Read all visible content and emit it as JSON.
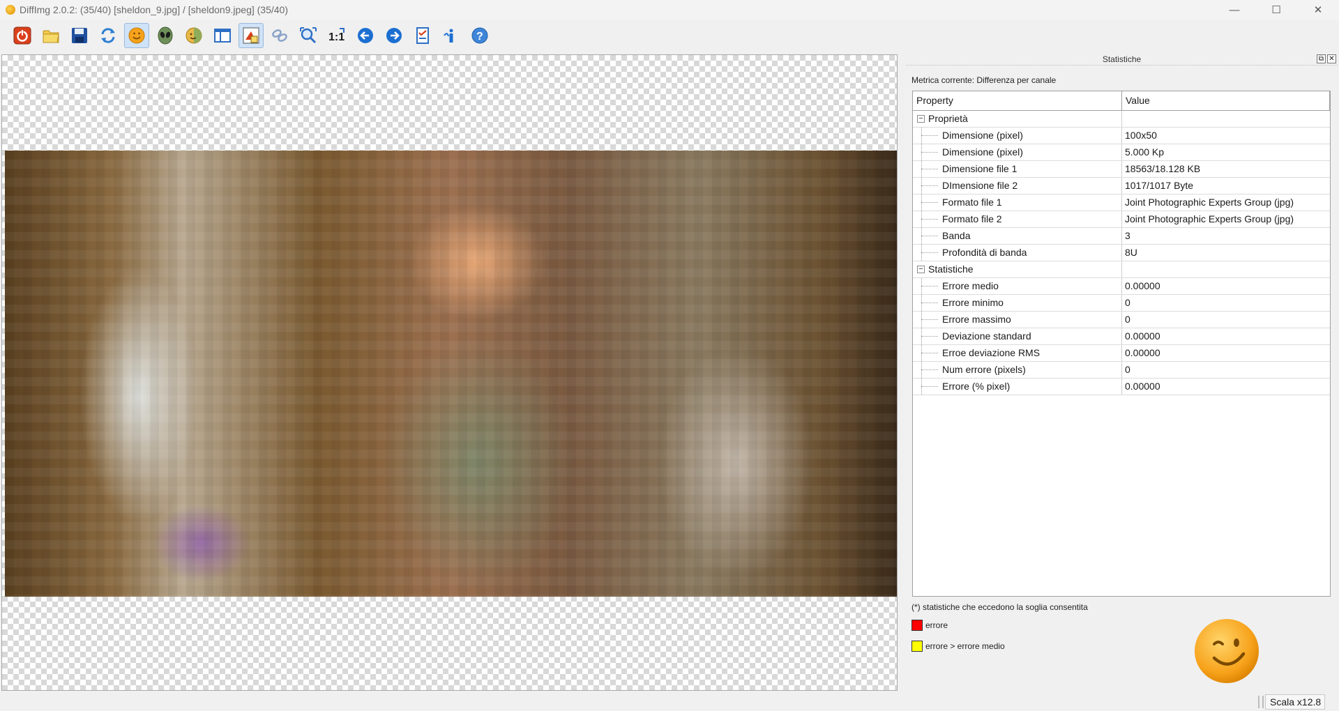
{
  "window": {
    "title": "DiffImg 2.0.2:  (35/40) [sheldon_9.jpg] / [sheldon9.jpeg] (35/40)",
    "minimize": "—",
    "maximize": "☐",
    "close": "✕"
  },
  "toolbar": {
    "buttons": [
      {
        "icon": "power-icon"
      },
      {
        "icon": "folder-open-icon"
      },
      {
        "icon": "save-icon"
      },
      {
        "icon": "refresh-icon"
      },
      {
        "icon": "smiley-icon",
        "active": true
      },
      {
        "icon": "alien-icon"
      },
      {
        "icon": "smiley-alt-icon"
      },
      {
        "icon": "split-view-icon"
      },
      {
        "icon": "highlight-diff-icon",
        "active": true
      },
      {
        "icon": "link-icon"
      },
      {
        "icon": "zoom-fit-icon"
      },
      {
        "icon": "zoom-actual-icon"
      },
      {
        "icon": "previous-icon"
      },
      {
        "icon": "next-icon"
      },
      {
        "icon": "checklist-icon"
      },
      {
        "icon": "info-icon"
      },
      {
        "icon": "help-icon"
      }
    ],
    "zoom_actual_label": "1:1"
  },
  "panel": {
    "title": "Statistiche",
    "float_btn": "⧉",
    "close_btn": "✕",
    "metric": "Metrica corrente: Differenza per canale",
    "table": {
      "col_property": "Property",
      "col_value": "Value",
      "groups": [
        {
          "name": "Proprietà",
          "expander": "−",
          "rows": [
            {
              "prop": "Dimensione (pixel)",
              "value": "100x50"
            },
            {
              "prop": "Dimensione (pixel)",
              "value": "5.000 Kp"
            },
            {
              "prop": "Dimensione file 1",
              "value": "18563/18.128 KB"
            },
            {
              "prop": "DImensione file 2",
              "value": "1017/1017 Byte"
            },
            {
              "prop": "Formato file 1",
              "value": "Joint Photographic Experts Group (jpg)"
            },
            {
              "prop": "Formato file 2",
              "value": "Joint Photographic Experts Group (jpg)"
            },
            {
              "prop": "Banda",
              "value": "3"
            },
            {
              "prop": "Profondità di banda",
              "value": "8U"
            }
          ]
        },
        {
          "name": "Statistiche",
          "expander": "−",
          "rows": [
            {
              "prop": "Errore medio",
              "value": "0.00000"
            },
            {
              "prop": "Errore minimo",
              "value": "0"
            },
            {
              "prop": "Errore massimo",
              "value": "0"
            },
            {
              "prop": "Deviazione standard",
              "value": "0.00000"
            },
            {
              "prop": "Erroe deviazione RMS",
              "value": "0.00000"
            },
            {
              "prop": "Num errore (pixels)",
              "value": "0"
            },
            {
              "prop": "Errore (% pixel)",
              "value": "0.00000"
            }
          ]
        }
      ]
    },
    "note": "(*) statistiche che eccedono la soglia consentita",
    "legend": [
      {
        "label": "errore",
        "color": "#ff0000"
      },
      {
        "label": "errore > errore medio",
        "color": "#ffff00"
      }
    ]
  },
  "status": {
    "scale": "Scala x12.8"
  },
  "colors": {
    "accent_blue": "#1c6fd1",
    "smiley": "#f7a21b"
  }
}
